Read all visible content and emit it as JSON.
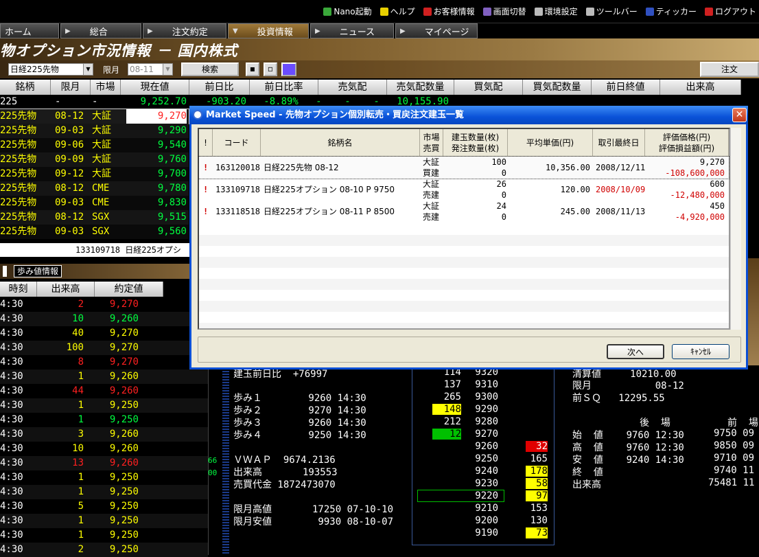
{
  "toplinks": [
    {
      "label": "Nano起動",
      "icon": "nano-icon",
      "color": "#3aa83a"
    },
    {
      "label": "ヘルプ",
      "icon": "help-icon",
      "color": "#e8d000"
    },
    {
      "label": "お客様情報",
      "icon": "customer-icon",
      "color": "#d02020"
    },
    {
      "label": "画面切替",
      "icon": "screen-switch-icon",
      "color": "#8060c0"
    },
    {
      "label": "環境設定",
      "icon": "settings-icon",
      "color": "#bbbbbb"
    },
    {
      "label": "ツールバー",
      "icon": "toolbar-icon",
      "color": "#bbbbbb"
    },
    {
      "label": "ティッカー",
      "icon": "ticker-icon",
      "color": "#3050c0"
    },
    {
      "label": "ログアウト",
      "icon": "logout-icon",
      "color": "#d02020"
    }
  ],
  "nav": [
    "ホーム",
    "総合",
    "注文約定",
    "投資情報",
    "ニュース",
    "マイページ"
  ],
  "nav_active": 3,
  "page_title": "物オプション市況情報 － 国内株式",
  "search": {
    "product": "日経225先物",
    "month_label": "限月",
    "month": "08-11",
    "search_btn": "検索",
    "order_btn": "注文"
  },
  "main_headers": [
    "銘柄",
    "限月",
    "市場",
    "現在値",
    "前日比",
    "前日比率",
    "売気配",
    "売気配数量",
    "買気配",
    "買気配数量",
    "前日終値",
    "出来高"
  ],
  "main_rows": [
    {
      "name": "225",
      "month": "-",
      "market": "-",
      "price": "9,252.70",
      "extra": "-903.20   -8.89%   -    -    -   10,155.90"
    },
    {
      "name": "225先物",
      "month": "08-12",
      "market": "大証",
      "price": "9,270"
    },
    {
      "name": "225先物",
      "month": "09-03",
      "market": "大証",
      "price": "9,290"
    },
    {
      "name": "225先物",
      "month": "09-06",
      "market": "大証",
      "price": "9,540"
    },
    {
      "name": "225先物",
      "month": "09-09",
      "market": "大証",
      "price": "9,760"
    },
    {
      "name": "225先物",
      "month": "09-12",
      "market": "大証",
      "price": "9,700"
    },
    {
      "name": "225先物",
      "month": "08-12",
      "market": "CME",
      "price": "9,780"
    },
    {
      "name": "225先物",
      "month": "09-03",
      "market": "CME",
      "price": "9,830"
    },
    {
      "name": "225先物",
      "month": "08-12",
      "market": "SGX",
      "price": "9,515"
    },
    {
      "name": "225先物",
      "month": "09-03",
      "market": "SGX",
      "price": "9,560"
    }
  ],
  "ticker_text": "133109718 日経225オプシ",
  "walk_tab": "歩み値情報",
  "trade_headers": [
    "時刻",
    "出来高",
    "約定値"
  ],
  "trades": [
    {
      "t": "4:30",
      "v": "2",
      "p": "9,270",
      "vc": "r",
      "pc": "r"
    },
    {
      "t": "4:30",
      "v": "10",
      "p": "9,260",
      "vc": "g",
      "pc": "g"
    },
    {
      "t": "4:30",
      "v": "40",
      "p": "9,270",
      "vc": "y",
      "pc": "y"
    },
    {
      "t": "4:30",
      "v": "100",
      "p": "9,270",
      "vc": "y",
      "pc": "y"
    },
    {
      "t": "4:30",
      "v": "8",
      "p": "9,270",
      "vc": "r",
      "pc": "r"
    },
    {
      "t": "4:30",
      "v": "1",
      "p": "9,260",
      "vc": "y",
      "pc": "y"
    },
    {
      "t": "4:30",
      "v": "44",
      "p": "9,260",
      "vc": "r",
      "pc": "r"
    },
    {
      "t": "4:30",
      "v": "1",
      "p": "9,250",
      "vc": "y",
      "pc": "y"
    },
    {
      "t": "4:30",
      "v": "1",
      "p": "9,250",
      "vc": "g",
      "pc": "g"
    },
    {
      "t": "4:30",
      "v": "3",
      "p": "9,260",
      "vc": "y",
      "pc": "y"
    },
    {
      "t": "4:30",
      "v": "10",
      "p": "9,260",
      "vc": "y",
      "pc": "y"
    },
    {
      "t": "4:30",
      "v": "13",
      "p": "9,260",
      "vc": "r",
      "pc": "r"
    },
    {
      "t": "4:30",
      "v": "1",
      "p": "9,250",
      "vc": "y",
      "pc": "y"
    },
    {
      "t": "4:30",
      "v": "1",
      "p": "9,250",
      "vc": "y",
      "pc": "y"
    },
    {
      "t": "4:30",
      "v": "5",
      "p": "9,250",
      "vc": "y",
      "pc": "y"
    },
    {
      "t": "4:30",
      "v": "1",
      "p": "9,250",
      "vc": "y",
      "pc": "y"
    },
    {
      "t": "4:30",
      "v": "1",
      "p": "9,250",
      "vc": "y",
      "pc": "y"
    },
    {
      "t": "4:30",
      "v": "2",
      "p": "9,250",
      "vc": "y",
      "pc": "y"
    }
  ],
  "info": {
    "l1": "建玉前日比  +76997",
    "walk1": "歩み１        9260 14:30",
    "walk2": "歩み２        9270 14:30",
    "walk3": "歩み３        9260 14:30",
    "walk4": "歩み４        9250 14:30",
    "vwap": "ＶＷＡＰ  9674.2136",
    "volume": "出来高       193553",
    "turnover": "売買代金 1872473070",
    "mhigh": "限月高値       17250 07-10-10",
    "mlow": "限月安値        9930 08-10-07",
    "sidenum1": "66",
    "sidenum2": "00"
  },
  "board": [
    {
      "qty": "114",
      "price": "9320",
      "bid": ""
    },
    {
      "qty": "137",
      "price": "9310",
      "bid": ""
    },
    {
      "qty": "265",
      "price": "9300",
      "bid": ""
    },
    {
      "qty": "148",
      "price": "9290",
      "bid": "",
      "qhl": true
    },
    {
      "qty": "212",
      "price": "9280",
      "bid": ""
    },
    {
      "qty": "12",
      "price": "9270",
      "bid": "",
      "qgreen": true
    },
    {
      "qty": "",
      "price": "9260",
      "bid": "32",
      "bred": true
    },
    {
      "qty": "",
      "price": "9250",
      "bid": "165"
    },
    {
      "qty": "",
      "price": "9240",
      "bid": "178",
      "bhl": true
    },
    {
      "qty": "",
      "price": "9230",
      "bid": "58",
      "bhl": true
    },
    {
      "qty": "",
      "price": "9220",
      "bid": "97",
      "bhl": true,
      "box": true
    },
    {
      "qty": "",
      "price": "9210",
      "bid": "153"
    },
    {
      "qty": "",
      "price": "9200",
      "bid": "130"
    },
    {
      "qty": "",
      "price": "9190",
      "bid": "73",
      "bhl": true
    }
  ],
  "right": {
    "settle": "清算値     10210.00",
    "month": "限月           08-12",
    "sq": "前ＳＱ   12295.55",
    "after": "後  場",
    "before": "前  場",
    "open": "始  値    9760 12:30",
    "open2": "9750 09",
    "high": "高  値    9760 12:30",
    "high2": "9850 09",
    "low": "安  値    9240 14:30",
    "low2": "9710 09",
    "close": "終  値",
    "close2": "9740 11",
    "vol": "出来高",
    "vol2": "75481 11"
  },
  "dialog": {
    "title": "Market Speed - 先物オプション個別転売・買戻注文建玉一覧",
    "headers": {
      "mark": "!",
      "code": "コード",
      "name": "銘柄名",
      "market": "市場\n売買",
      "qty": "建玉数量(枚)\n発注数量(枚)",
      "avg": "平均単価(円)",
      "last": "取引最終日",
      "val": "評価価格(円)\n評価損益額(円)"
    },
    "rows": [
      {
        "mark": "!",
        "code": "163120018",
        "name": "日経225先物 08-12",
        "market": "大証",
        "side": "買建",
        "qty": "100",
        "ord": "0",
        "avg": "10,356.00",
        "last": "2008/12/11",
        "lastred": false,
        "val": "9,270",
        "pl": "-108,600,000"
      },
      {
        "mark": "!",
        "code": "133109718",
        "name": "日経225オプション 08-10 P 9750",
        "market": "大証",
        "side": "売建",
        "qty": "26",
        "ord": "0",
        "avg": "120.00",
        "last": "2008/10/09",
        "lastred": true,
        "val": "600",
        "pl": "-12,480,000"
      },
      {
        "mark": "!",
        "code": "133118518",
        "name": "日経225オプション 08-11 P 8500",
        "market": "大証",
        "side": "売建",
        "qty": "24",
        "ord": "0",
        "avg": "245.00",
        "last": "2008/11/13",
        "lastred": false,
        "val": "450",
        "pl": "-4,920,000"
      }
    ],
    "next_btn": "次へ",
    "cancel_btn": "ｷｬﾝｾﾙ"
  }
}
